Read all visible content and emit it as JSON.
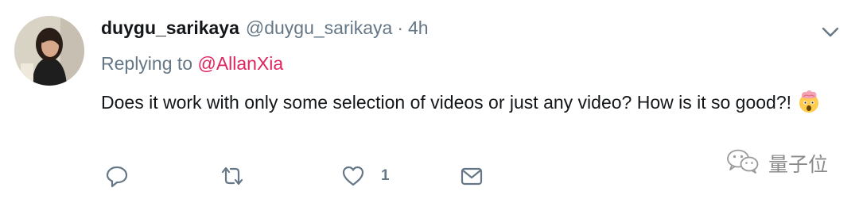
{
  "tweet": {
    "display_name": "duygu_sarikaya",
    "handle": "@duygu_sarikaya",
    "separator": "·",
    "timestamp": "4h",
    "reply_prefix": "Replying to",
    "reply_to": "@AllanXia",
    "text": "Does it work with only some selection of videos or just any video? How is it so good?!",
    "emoji": "exploding-head-emoji"
  },
  "actions": {
    "reply_icon": "reply-icon",
    "retweet_icon": "retweet-icon",
    "like_icon": "heart-icon",
    "like_count": "1",
    "share_icon": "share-icon"
  },
  "watermark": {
    "text": "量子位",
    "icon": "wechat-icon"
  },
  "colors": {
    "text": "#14171a",
    "muted": "#657786",
    "mention": "#e0245e",
    "background": "#ffffff"
  }
}
